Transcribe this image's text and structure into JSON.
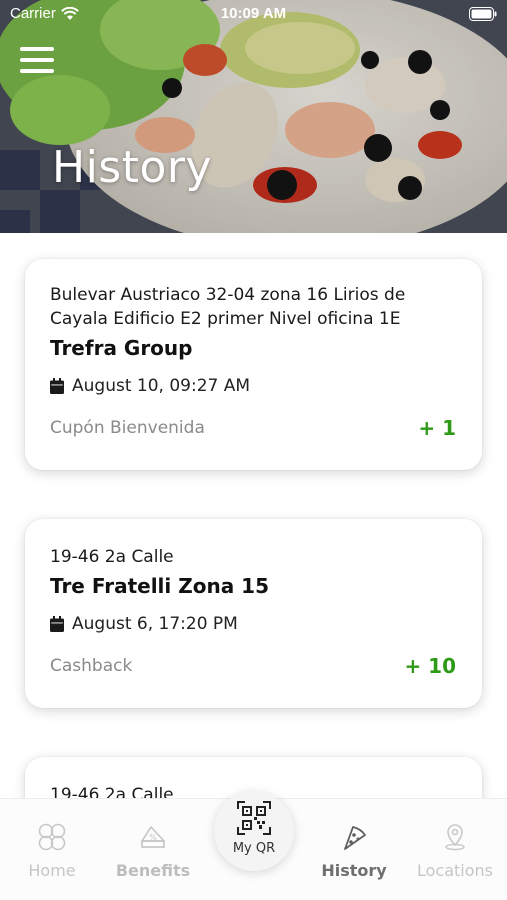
{
  "status_bar": {
    "carrier": "Carrier",
    "time": "10:09 AM"
  },
  "header": {
    "title": "History"
  },
  "history": [
    {
      "address": "Bulevar Austriaco 32-04 zona 16 Lirios de Cayala Edificio E2 primer Nivel oficina 1E",
      "name": "Trefra Group",
      "date": "August 10, 09:27 AM",
      "type": "Cupón Bienvenida",
      "points": "+ 1"
    },
    {
      "address": "19-46 2a Calle",
      "name": "Tre Fratelli Zona 15",
      "date": "August 6, 17:20 PM",
      "type": "Cashback",
      "points": "+ 10"
    },
    {
      "address": "19-46 2a Calle"
    }
  ],
  "tabbar": {
    "home": "Home",
    "benefits": "Benefits",
    "my_qr": "My QR",
    "history": "History",
    "locations": "Locations"
  },
  "colors": {
    "accent_green": "#2f9a17",
    "active_tab": "#6f6f6f",
    "inactive_tab": "#c6c6c6"
  },
  "icons": [
    "wifi-icon",
    "battery-icon",
    "menu-icon",
    "calendar-icon",
    "home-icon",
    "benefits-icon",
    "qr-icon",
    "history-icon",
    "location-icon"
  ]
}
